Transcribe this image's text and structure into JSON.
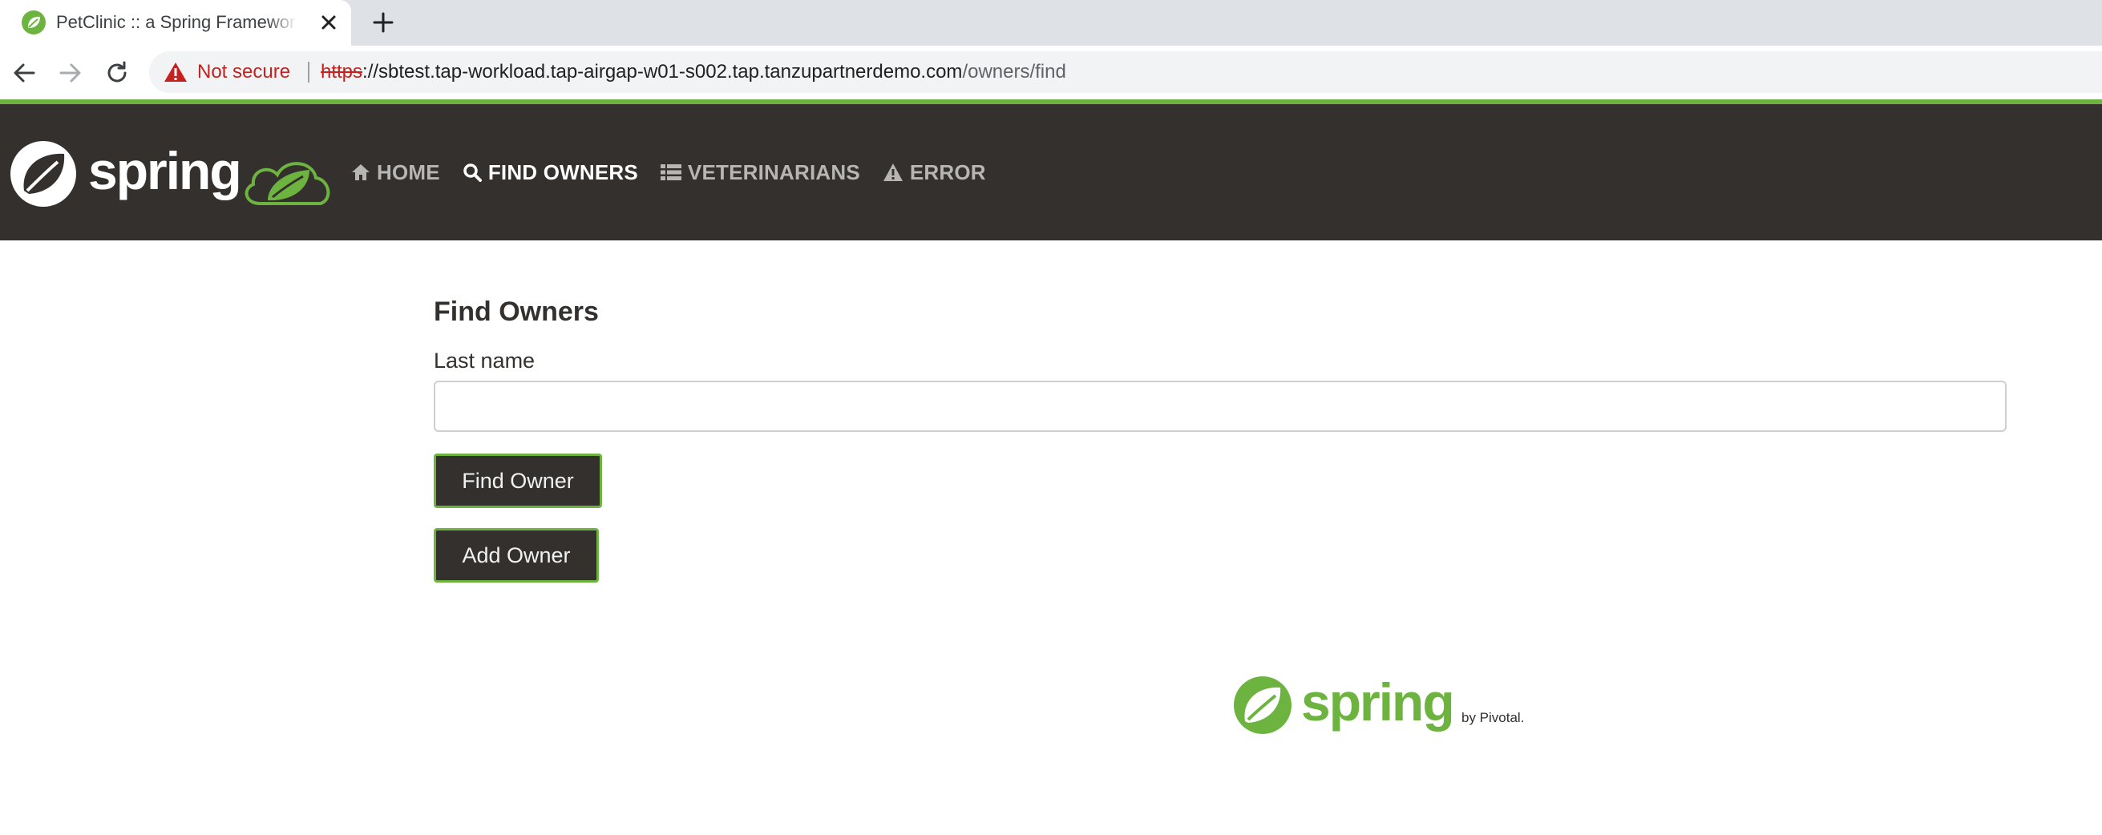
{
  "browser": {
    "tab_title": "PetClinic :: a Spring Framework demonstration",
    "security_label": "Not secure",
    "url_scheme": "https",
    "url_host": "://sbtest.tap-workload.tap-airgap-w01-s002.tap.tanzupartnerdemo.com",
    "url_path": "/owners/find"
  },
  "navbar": {
    "brand": "spring",
    "items": [
      {
        "label": "HOME",
        "icon": "home-icon",
        "active": false
      },
      {
        "label": "FIND OWNERS",
        "icon": "search-icon",
        "active": true
      },
      {
        "label": "VETERINARIANS",
        "icon": "list-icon",
        "active": false
      },
      {
        "label": "ERROR",
        "icon": "warning-icon",
        "active": false
      }
    ]
  },
  "form": {
    "title": "Find Owners",
    "last_name_label": "Last name",
    "last_name_value": "",
    "find_button": "Find Owner",
    "add_button": "Add Owner"
  },
  "footer": {
    "logo_text": "spring",
    "byline": "by Pivotal."
  },
  "colors": {
    "brand_green": "#6db33f",
    "navbar_bg": "#34302d",
    "warning_red": "#c5221f"
  }
}
